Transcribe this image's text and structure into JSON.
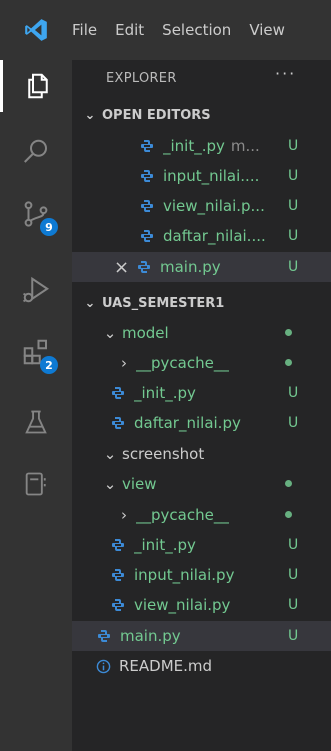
{
  "menu": {
    "file": "File",
    "edit": "Edit",
    "selection": "Selection",
    "view": "View"
  },
  "activity": {
    "scm_badge": "9",
    "extensions_badge": "2"
  },
  "explorer": {
    "title": "EXPLORER",
    "more": "···"
  },
  "open_editors": {
    "header": "OPEN EDITORS",
    "items": [
      {
        "name": "_init_.py",
        "desc": "m...",
        "status": "U"
      },
      {
        "name": "input_nilai....",
        "status": "U"
      },
      {
        "name": "view_nilai.p...",
        "status": "U"
      },
      {
        "name": "daftar_nilai....",
        "status": "U"
      },
      {
        "name": "main.py",
        "status": "U"
      }
    ]
  },
  "workspace": {
    "header": "UAS_SEMESTER1",
    "items": [
      {
        "type": "folder-open",
        "name": "model"
      },
      {
        "type": "folder-closed",
        "name": "__pycache__"
      },
      {
        "type": "file",
        "name": "_init_.py",
        "status": "U"
      },
      {
        "type": "file",
        "name": "daftar_nilai.py",
        "status": "U"
      },
      {
        "type": "folder-open",
        "name": "screenshot"
      },
      {
        "type": "folder-open",
        "name": "view"
      },
      {
        "type": "folder-closed",
        "name": "__pycache__"
      },
      {
        "type": "file",
        "name": "_init_.py",
        "status": "U"
      },
      {
        "type": "file",
        "name": "input_nilai.py",
        "status": "U"
      },
      {
        "type": "file",
        "name": "view_nilai.py",
        "status": "U"
      },
      {
        "type": "file",
        "name": "main.py",
        "status": "U"
      },
      {
        "type": "info-file",
        "name": "README.md"
      }
    ]
  },
  "colors": {
    "untracked": "#73c991",
    "badge": "#0e7ad3",
    "sidebar": "#252526",
    "activitybar": "#333333"
  }
}
